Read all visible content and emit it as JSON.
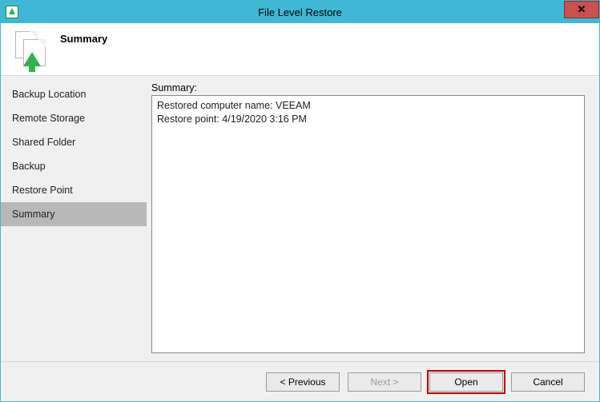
{
  "window": {
    "title": "File Level Restore",
    "close_glyph": "✕"
  },
  "header": {
    "title": "Summary"
  },
  "sidebar": {
    "items": [
      {
        "label": "Backup Location",
        "selected": false
      },
      {
        "label": "Remote Storage",
        "selected": false
      },
      {
        "label": "Shared Folder",
        "selected": false
      },
      {
        "label": "Backup",
        "selected": false
      },
      {
        "label": "Restore Point",
        "selected": false
      },
      {
        "label": "Summary",
        "selected": true
      }
    ]
  },
  "main": {
    "summary_label": "Summary:",
    "summary_lines": [
      "Restored computer name: VEEAM",
      "Restore point: 4/19/2020 3:16 PM"
    ]
  },
  "footer": {
    "previous": "< Previous",
    "next": "Next >",
    "open": "Open",
    "cancel": "Cancel"
  }
}
